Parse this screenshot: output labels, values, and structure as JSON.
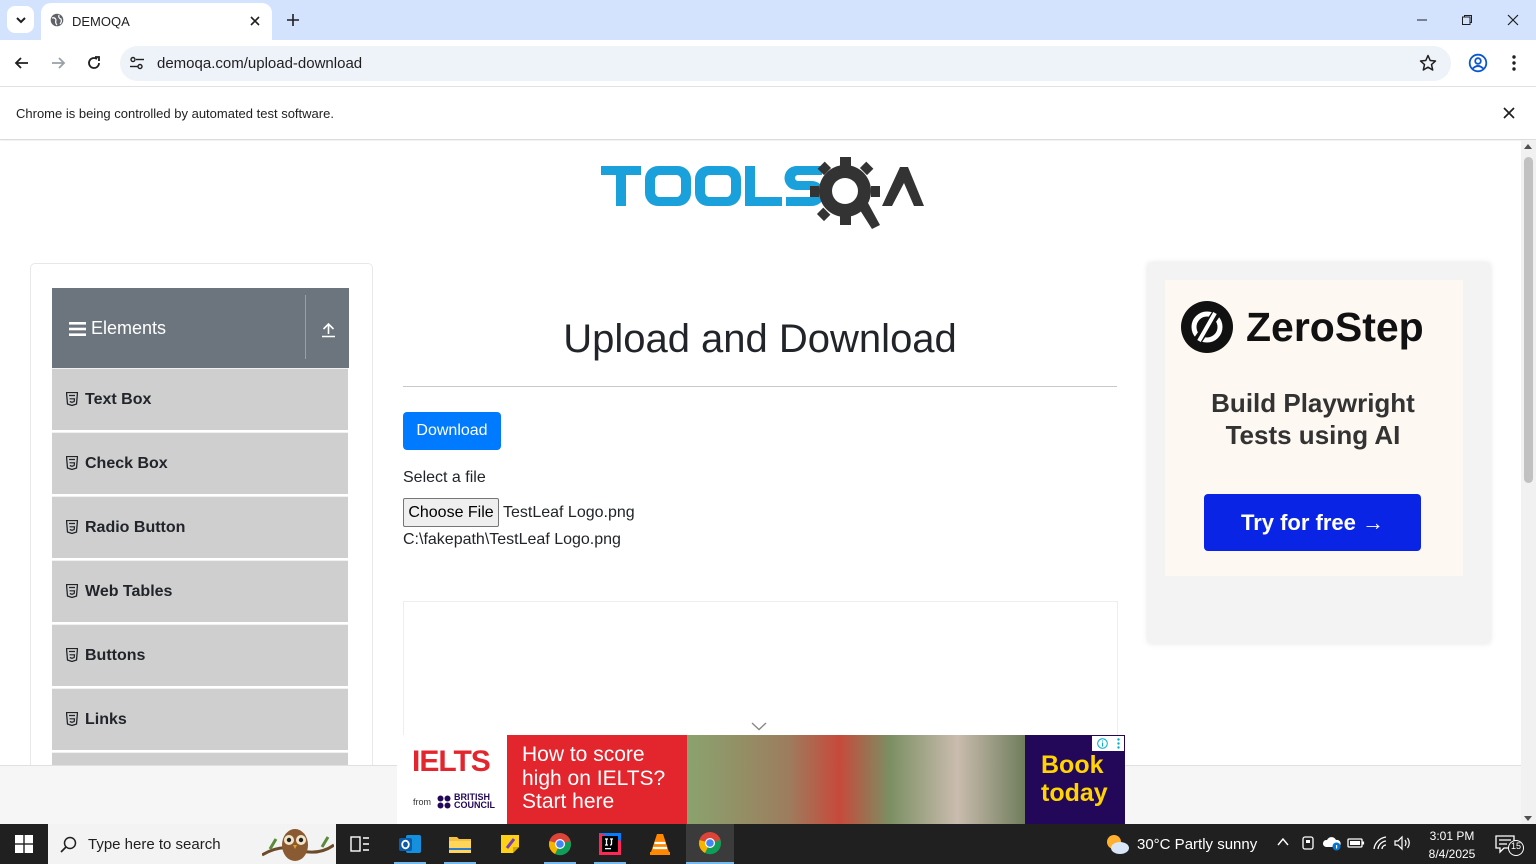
{
  "browser": {
    "tab_title": "DEMOQA",
    "url": "demoqa.com/upload-download",
    "infobar_message": "Chrome is being controlled by automated test software."
  },
  "sidebar": {
    "group_label": "Elements",
    "items": [
      {
        "label": "Text Box"
      },
      {
        "label": "Check Box"
      },
      {
        "label": "Radio Button"
      },
      {
        "label": "Web Tables"
      },
      {
        "label": "Buttons"
      },
      {
        "label": "Links"
      }
    ]
  },
  "main": {
    "title": "Upload and Download",
    "download_label": "Download",
    "select_label": "Select a file",
    "choose_file_label": "Choose File",
    "chosen_file": "TestLeaf Logo.png",
    "uploaded_path": "C:\\fakepath\\TestLeaf Logo.png"
  },
  "side_ad": {
    "brand": "ZeroStep",
    "headline_line1": "Build Playwright",
    "headline_line2": "Tests using AI",
    "cta": "Try for free →"
  },
  "banner_ad": {
    "brand": "IELTS",
    "from": "from",
    "partner_line1": "BRITISH",
    "partner_line2": "COUNCIL",
    "line1": "How to score",
    "line2": "high on IELTS?",
    "line3": "Start here",
    "cta_line1": "Book",
    "cta_line2": "today"
  },
  "taskbar": {
    "search_placeholder": "Type here to search",
    "weather": "30°C  Partly sunny",
    "time": "3:01 PM",
    "date": "8/4/2025",
    "notification_count": "15"
  },
  "colors": {
    "primary_button": "#007bff",
    "sidebar_header": "#6c757d",
    "sidebar_item": "#cfcfcf",
    "zerostep_cta": "#0a24e6",
    "ielts_red": "#e3262d",
    "ielts_navy": "#23085a"
  }
}
